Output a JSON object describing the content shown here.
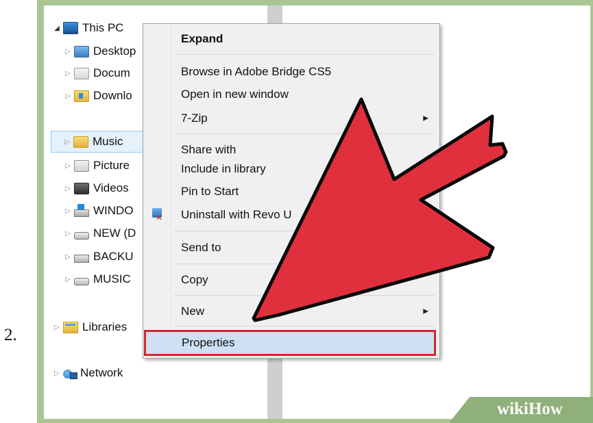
{
  "step_number": "2.",
  "tree": {
    "items": [
      {
        "label": "This PC",
        "icon": "computer-icon",
        "expander": "open",
        "selected": false
      },
      {
        "label": "Desktop",
        "icon": "desktop-folder-icon",
        "expander": "closed",
        "selected": false
      },
      {
        "label": "Docum",
        "icon": "documents-folder-icon",
        "expander": "closed",
        "selected": false
      },
      {
        "label": "Downlo",
        "icon": "downloads-folder-icon",
        "expander": "closed",
        "selected": false
      },
      {
        "label": "Music",
        "icon": "music-folder-icon",
        "expander": "closed",
        "selected": true
      },
      {
        "label": "Picture",
        "icon": "pictures-folder-icon",
        "expander": "closed",
        "selected": false
      },
      {
        "label": "Videos",
        "icon": "videos-folder-icon",
        "expander": "closed",
        "selected": false
      },
      {
        "label": "WINDO",
        "icon": "windows-drive-icon",
        "expander": "closed",
        "selected": false
      },
      {
        "label": "NEW (D",
        "icon": "drive-icon",
        "expander": "closed",
        "selected": false
      },
      {
        "label": "BACKU",
        "icon": "backup-drive-icon",
        "expander": "closed",
        "selected": false
      },
      {
        "label": "MUSIC",
        "icon": "drive-icon",
        "expander": "closed",
        "selected": false
      },
      {
        "label": "Libraries",
        "icon": "libraries-icon",
        "expander": "closed",
        "selected": false
      },
      {
        "label": "Network",
        "icon": "network-icon",
        "expander": "closed",
        "selected": false
      }
    ]
  },
  "context_menu": {
    "items": [
      {
        "label": "Expand",
        "bold": true
      },
      {
        "label": "Browse in Adobe Bridge CS5"
      },
      {
        "label": "Open in new window"
      },
      {
        "label": "7-Zip",
        "submenu": true
      },
      {
        "label": "Share with"
      },
      {
        "label": "Include in library"
      },
      {
        "label": "Pin to Start"
      },
      {
        "label": "Uninstall with Revo U",
        "icon": "revo-uninstaller-icon"
      },
      {
        "label": "Send to"
      },
      {
        "label": "Copy"
      },
      {
        "label": "New",
        "submenu": true
      },
      {
        "label": "Properties",
        "highlighted": true
      }
    ]
  },
  "annotation": {
    "arrow_color": "#e0303d",
    "highlight_color": "#d8232a"
  },
  "watermark": {
    "wiki": "wiki",
    "how": "How"
  }
}
